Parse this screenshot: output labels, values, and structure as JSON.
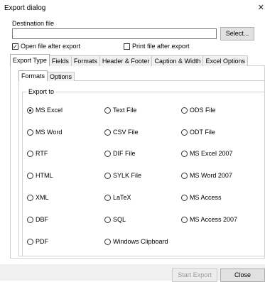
{
  "window": {
    "title": "Export dialog",
    "close_glyph": "✕"
  },
  "destination": {
    "label": "Destination file",
    "value": "",
    "select_label": "Select..."
  },
  "options": {
    "open_after": {
      "label": "Open file after export",
      "checked": true
    },
    "print_after": {
      "label": "Print file after export",
      "checked": false
    }
  },
  "tabs": [
    "Export Type",
    "Fields",
    "Formats",
    "Header & Footer",
    "Caption & Width",
    "Excel Options"
  ],
  "active_tab": "Export Type",
  "subtabs": [
    "Formats",
    "Options"
  ],
  "active_subtab": "Formats",
  "group": {
    "label": "Export to",
    "rows": [
      [
        "MS Excel",
        "Text File",
        "ODS File"
      ],
      [
        "MS Word",
        "CSV File",
        "ODT File"
      ],
      [
        "RTF",
        "DIF File",
        "MS Excel 2007"
      ],
      [
        "HTML",
        "SYLK File",
        "MS Word 2007"
      ],
      [
        "XML",
        "LaTeX",
        "MS Access"
      ],
      [
        "DBF",
        "SQL",
        "MS Access 2007"
      ],
      [
        "PDF",
        "Windows Clipboard",
        ""
      ]
    ],
    "selected": "MS Excel"
  },
  "buttons": {
    "start_export": "Start Export",
    "close": "Close"
  }
}
